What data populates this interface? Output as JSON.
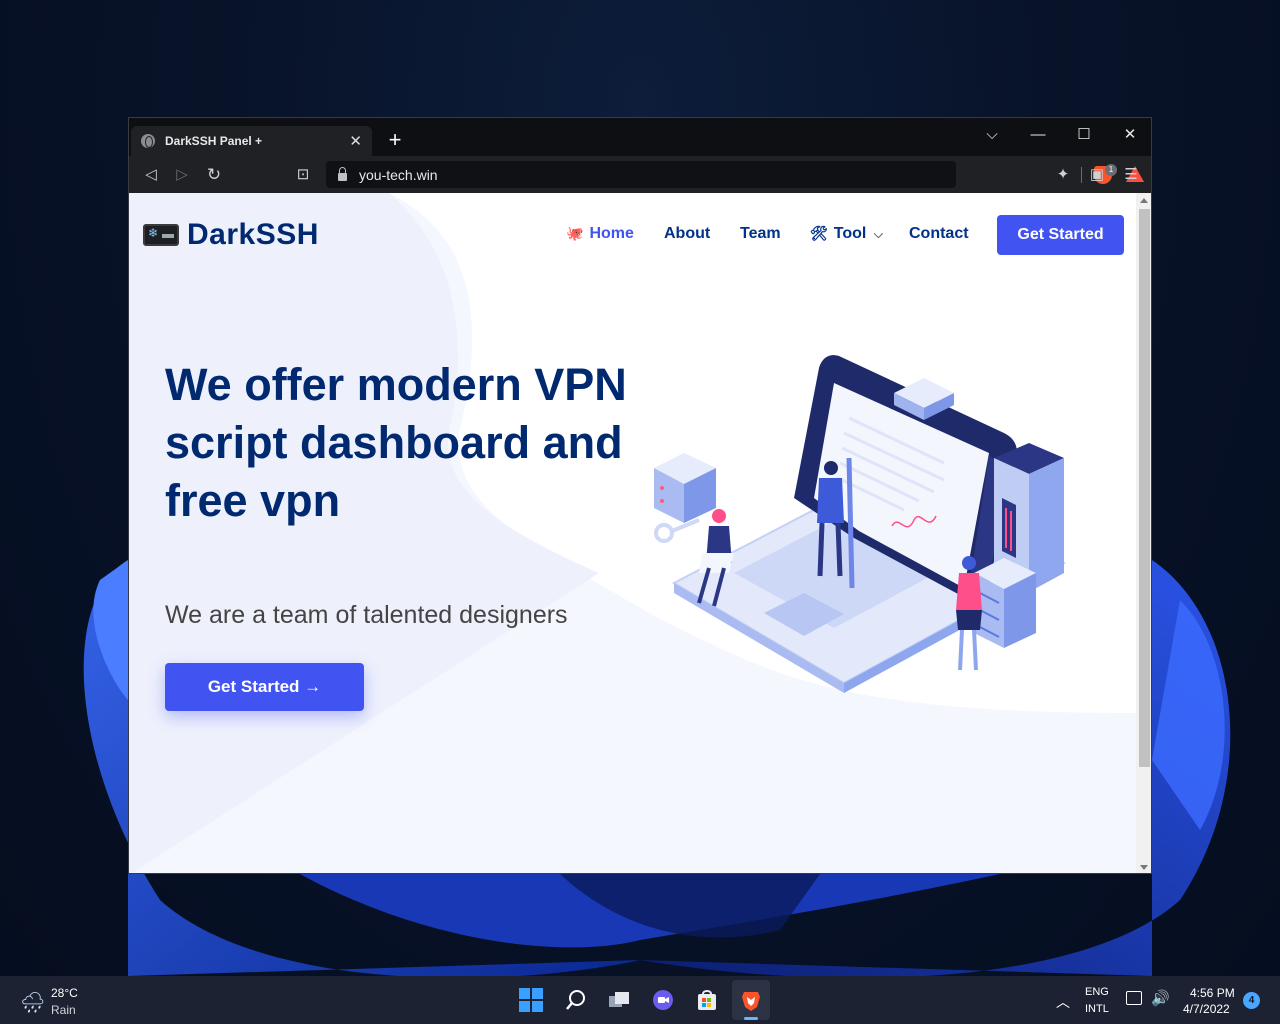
{
  "browser": {
    "tab_title": "DarkSSH Panel +",
    "tab_close": "✕",
    "new_tab": "+",
    "url": "you-tech.win",
    "shield_count": "1",
    "controls": {
      "dropdown": "⌵",
      "minimize": "—",
      "maximize": "☐",
      "close": "✕"
    },
    "nav": {
      "back": "◁",
      "forward": "▷",
      "reload": "↻",
      "bookmark": "⊡"
    },
    "tools": {
      "extensions": "✦",
      "wallet": "▣",
      "menu": "☰"
    }
  },
  "site": {
    "brand": "DarkSSH",
    "nav": [
      {
        "label": "Home",
        "active": true
      },
      {
        "label": "About"
      },
      {
        "label": "Team"
      },
      {
        "label": "Tool"
      },
      {
        "label": "Contact"
      }
    ],
    "tool_chevron": "⌵",
    "cta_top": "Get Started",
    "hero": {
      "title": "We offer modern VPN script dashboard and free vpn",
      "subtitle": "We are a team of talented designers",
      "button": "Get Started →"
    },
    "accent_color": "#4154f1",
    "heading_color": "#012970"
  },
  "taskbar": {
    "weather_temp": "28°C",
    "weather_cond": "Rain",
    "lang_line1": "ENG",
    "lang_line2": "INTL",
    "time": "4:56 PM",
    "date": "4/7/2022",
    "notifications": "4",
    "tray_chevron": "︿",
    "volume": "🔊",
    "weather_icon": "🌧"
  }
}
